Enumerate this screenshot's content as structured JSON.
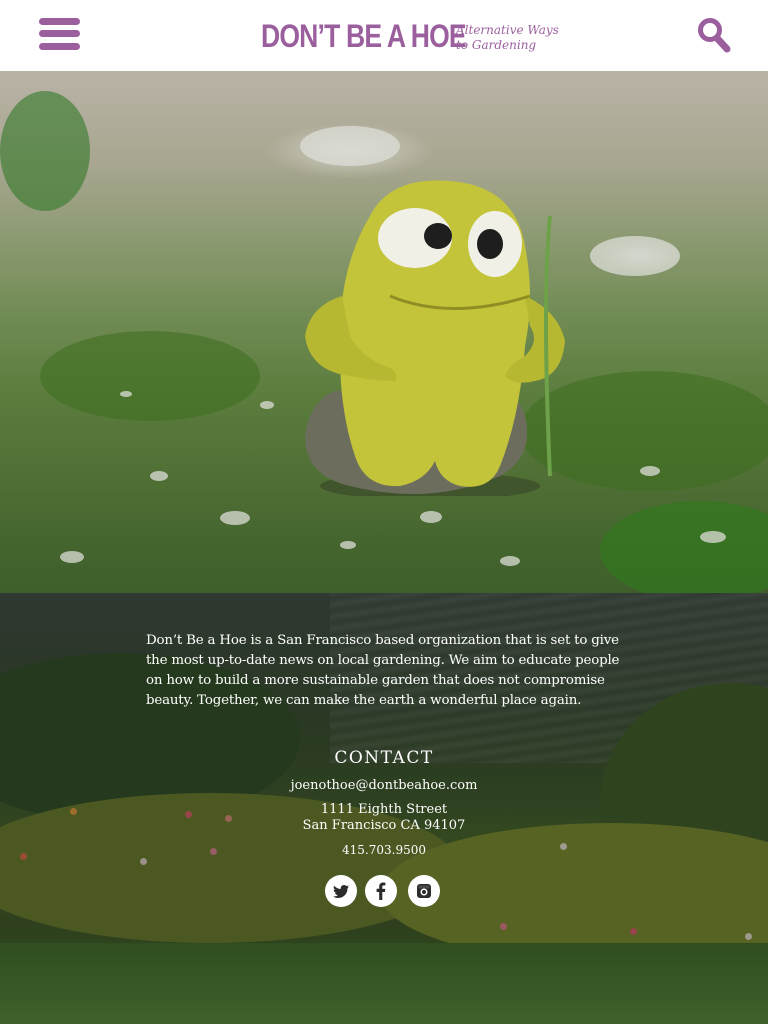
{
  "header": {
    "logo_main": "DON’T BE A HOE",
    "logo_tag_line1": "Alternative Ways",
    "logo_tag_line2": "to Gardening",
    "menu_icon": "hamburger-menu-icon",
    "search_icon": "search-icon"
  },
  "colors": {
    "brand": "#9b5f9e",
    "text_light": "#ffffff"
  },
  "about": {
    "text": "Don’t Be a Hoe is a San Francisco based organization that is set to give the most up-to-date news on local gardening. We aim to educate people on how to build a more sustainable garden that does not compromise beauty. Together, we can make the earth a wonderful place again."
  },
  "contact": {
    "title": "CONTACT",
    "email": "joenothoe@dontbeahoe.com",
    "address_line1": "1111 Eighth Street",
    "address_line2": "San Francisco CA 94107",
    "phone": "415.703.9500"
  },
  "social": {
    "twitter_icon": "twitter-icon",
    "facebook_icon": "facebook-icon",
    "instagram_icon": "instagram-icon"
  }
}
